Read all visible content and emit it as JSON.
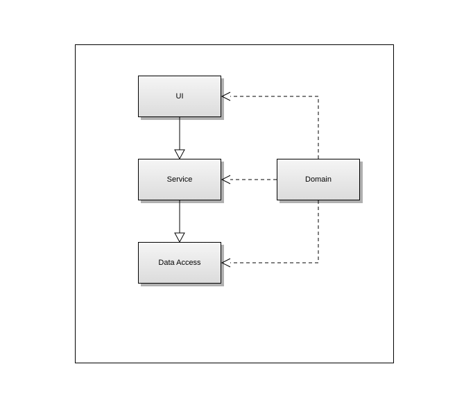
{
  "boxes": {
    "ui": {
      "label": "UI"
    },
    "service": {
      "label": "Service"
    },
    "dataAccess": {
      "label": "Data Access"
    },
    "domain": {
      "label": "Domain"
    }
  }
}
